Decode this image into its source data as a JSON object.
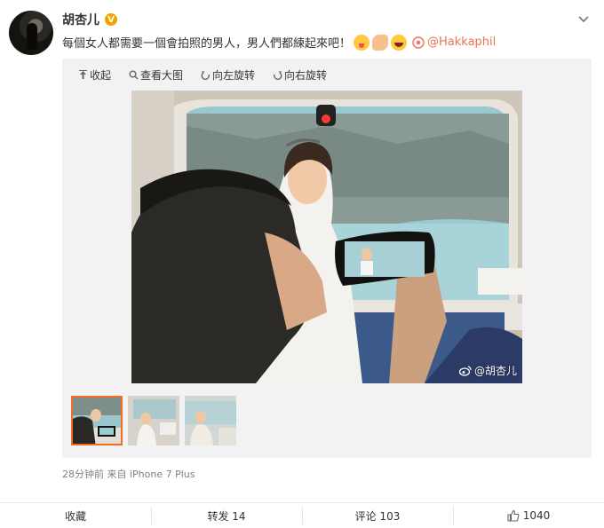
{
  "post": {
    "author": "胡杏儿",
    "verified_badge": "V",
    "text": "每個女人都需要一個會拍照的男人，男人們都練起來吧！",
    "emoji_icons": [
      "tongue-emoji-icon",
      "muscle-emoji-icon",
      "laugh-emoji-icon"
    ],
    "mention": "@Hakkaphil",
    "meta": "28分钟前 来自 iPhone 7 Plus"
  },
  "media_toolbar": {
    "collapse": "收起",
    "view_large": "查看大图",
    "rotate_left": "向左旋转",
    "rotate_right": "向右旋转"
  },
  "photo": {
    "watermark": "@胡杏儿"
  },
  "thumbnails": [
    {
      "selected": true
    },
    {
      "selected": false
    },
    {
      "selected": false
    }
  ],
  "actions": {
    "favorite": "收藏",
    "repost": "转发 14",
    "comment": "评论 103",
    "like": "1040"
  },
  "colors": {
    "accent": "#eb7350",
    "badge": "#f4a200",
    "selected_thumb_border": "#f36c21"
  }
}
